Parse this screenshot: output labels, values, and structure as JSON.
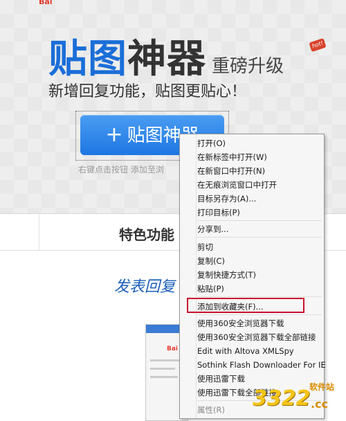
{
  "page": {
    "top_logo": "Bai",
    "title_blue": "贴图",
    "title_dark": "神器",
    "title_sub": "重磅升级",
    "hot_badge": "hot!",
    "slogan": "新增回复功能，贴图更贴心！",
    "cta_plus": "+",
    "cta_label": "贴图神器",
    "hint": "右键点击按钮 添加至浏",
    "feature_title": "特色功能",
    "handwriting": "发表回复",
    "preview_logo": "Bai"
  },
  "context_menu": {
    "items": [
      {
        "label": "打开(O)"
      },
      {
        "label": "在新标签中打开(W)"
      },
      {
        "label": "在新窗口中打开(N)"
      },
      {
        "label": "在无痕浏览窗口中打开"
      },
      {
        "label": "目标另存为(A)..."
      },
      {
        "label": "打印目标(P)"
      },
      {
        "label": "分享到..."
      },
      {
        "label": "剪切"
      },
      {
        "label": "复制(C)"
      },
      {
        "label": "复制快捷方式(T)"
      },
      {
        "label": "粘贴(P)"
      },
      {
        "label": "添加到收藏夹(F)..."
      },
      {
        "label": "使用360安全浏览器下载"
      },
      {
        "label": "使用360安全浏览器下载全部链接"
      },
      {
        "label": "Edit with Altova XMLSpy"
      },
      {
        "label": "Sothink Flash Downloader For IE"
      },
      {
        "label": "使用迅雷下载"
      },
      {
        "label": "使用迅雷下载全部链接"
      },
      {
        "label": "属性(R)"
      }
    ],
    "highlight_color": "#c8102e"
  },
  "watermark": {
    "number": "3322",
    "label": "软件站",
    "domain": ".cc"
  }
}
